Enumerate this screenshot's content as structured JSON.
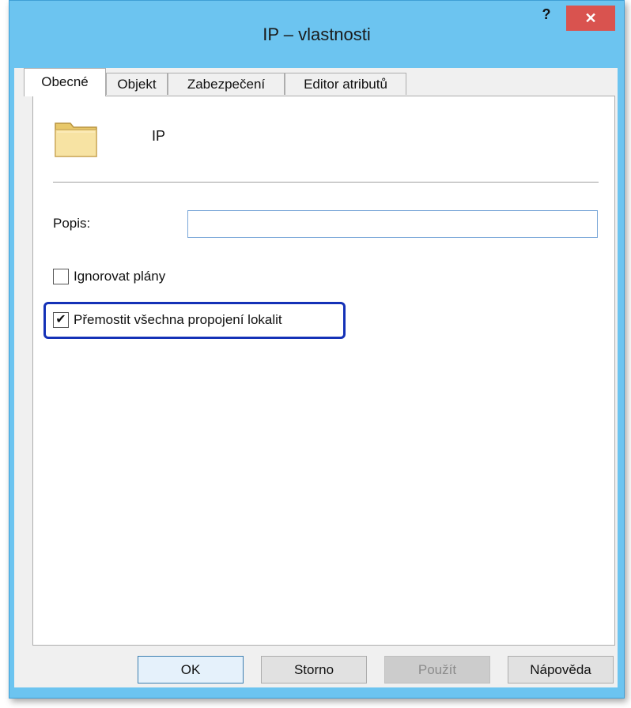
{
  "window": {
    "title": "IP – vlastnosti",
    "help_label": "?",
    "close_label": "✕"
  },
  "tabs": [
    {
      "label": "Obecné",
      "active": true
    },
    {
      "label": "Objekt",
      "active": false
    },
    {
      "label": "Zabezpečení",
      "active": false
    },
    {
      "label": "Editor atributů",
      "active": false
    }
  ],
  "general": {
    "object_name": "IP",
    "description_label": "Popis:",
    "description_value": "",
    "ignore_schedules": {
      "label": "Ignorovat plány",
      "checked": false
    },
    "bridge_all_links": {
      "label": "Přemostit všechna propojení lokalit",
      "checked": true,
      "checkmark": "✔"
    }
  },
  "buttons": {
    "ok": "OK",
    "cancel": "Storno",
    "apply": "Použít",
    "help": "Nápověda"
  },
  "colors": {
    "title_bar": "#6cc4f0",
    "close_button": "#d9534f",
    "highlight": "#1431b7"
  }
}
